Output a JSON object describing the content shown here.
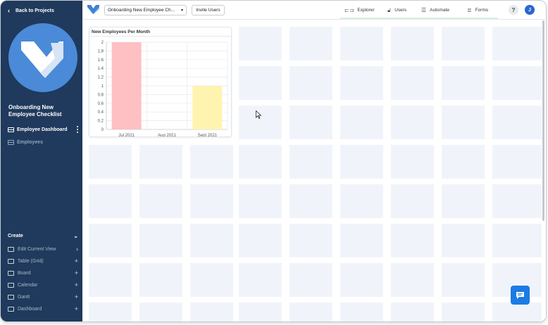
{
  "sidebar": {
    "back_label": "Back to Projects",
    "project_title": "Onboarding New Employee Checklist",
    "nav": [
      {
        "label": "Employee Dashboard",
        "icon": "dashboard-icon",
        "active": true
      },
      {
        "label": "Employees",
        "icon": "table-icon",
        "active": false
      }
    ],
    "create_label": "Create",
    "create_items": [
      {
        "label": "Edit Current View",
        "icon": "edit-icon",
        "action": "chevron-right"
      },
      {
        "label": "Table (Grid)",
        "icon": "table-icon",
        "action": "plus"
      },
      {
        "label": "Board",
        "icon": "board-icon",
        "action": "plus"
      },
      {
        "label": "Calendar",
        "icon": "calendar-icon",
        "action": "plus"
      },
      {
        "label": "Gantt",
        "icon": "gantt-icon",
        "action": "plus"
      },
      {
        "label": "Dashboard",
        "icon": "dashboard-icon",
        "action": "plus"
      }
    ],
    "colors": {
      "background": "#1f3a5c",
      "logo_circle": "#4a8ad8"
    }
  },
  "topbar": {
    "project_select_value": "Onboarding New Employee Ch...",
    "invite_label": "Invite Users",
    "tabs": [
      {
        "label": "Explorer",
        "icon": "explorer-icon"
      },
      {
        "label": "Users",
        "icon": "lock-icon"
      },
      {
        "label": "Automate",
        "icon": "automate-icon"
      },
      {
        "label": "Forms",
        "icon": "forms-icon"
      }
    ],
    "help_label": "?",
    "avatar_initial": "J"
  },
  "widget": {
    "title": "New Employees Per Month"
  },
  "chart_data": {
    "type": "bar",
    "title": "New Employees Per Month",
    "categories": [
      "Jul 2021",
      "Aug 2021",
      "Sept 2021"
    ],
    "values": [
      2,
      0,
      1
    ],
    "bar_colors": [
      "#ffc0c3",
      "#fff3b0",
      "#fff3b0"
    ],
    "yticks": [
      "0",
      "0.2",
      "0.4",
      "0.6",
      "0.8",
      "1",
      "1.2",
      "1.4",
      "1.6",
      "1.8",
      "2"
    ],
    "ylim": [
      0,
      2
    ],
    "grid": true,
    "xlabel": "",
    "ylabel": ""
  }
}
